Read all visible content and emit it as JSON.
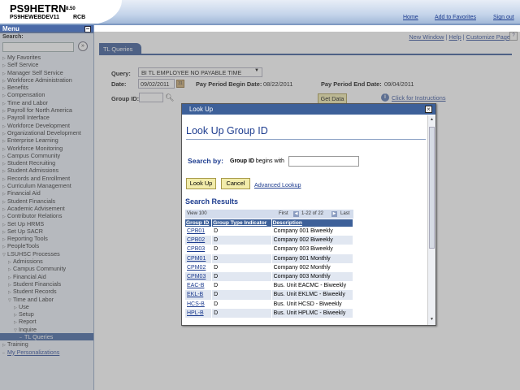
{
  "header": {
    "app_title": "PS9HETRN",
    "app_version": "8.50",
    "database": "PS9HEWEBDEV11",
    "user_id": "RCB",
    "links": {
      "home": "Home",
      "add_to_favorites": "Add to Favorites",
      "sign_out": "Sign out"
    }
  },
  "menu": {
    "title": "Menu",
    "collapse_glyph": "−",
    "search_label": "Search:",
    "search_go_glyph": "»",
    "items": [
      {
        "label": "My Favorites",
        "level": 0,
        "expanded": false
      },
      {
        "label": "Self Service",
        "level": 0,
        "expanded": false
      },
      {
        "label": "Manager Self Service",
        "level": 0,
        "expanded": false
      },
      {
        "label": "Workforce Administration",
        "level": 0,
        "expanded": false
      },
      {
        "label": "Benefits",
        "level": 0,
        "expanded": false
      },
      {
        "label": "Compensation",
        "level": 0,
        "expanded": false
      },
      {
        "label": "Time and Labor",
        "level": 0,
        "expanded": false
      },
      {
        "label": "Payroll for North America",
        "level": 0,
        "expanded": false
      },
      {
        "label": "Payroll Interface",
        "level": 0,
        "expanded": false
      },
      {
        "label": "Workforce Development",
        "level": 0,
        "expanded": false
      },
      {
        "label": "Organizational Development",
        "level": 0,
        "expanded": false
      },
      {
        "label": "Enterprise Learning",
        "level": 0,
        "expanded": false
      },
      {
        "label": "Workforce Monitoring",
        "level": 0,
        "expanded": false
      },
      {
        "label": "Campus Community",
        "level": 0,
        "expanded": false
      },
      {
        "label": "Student Recruiting",
        "level": 0,
        "expanded": false
      },
      {
        "label": "Student Admissions",
        "level": 0,
        "expanded": false
      },
      {
        "label": "Records and Enrollment",
        "level": 0,
        "expanded": false
      },
      {
        "label": "Curriculum Management",
        "level": 0,
        "expanded": false
      },
      {
        "label": "Financial Aid",
        "level": 0,
        "expanded": false
      },
      {
        "label": "Student Financials",
        "level": 0,
        "expanded": false
      },
      {
        "label": "Academic Advisement",
        "level": 0,
        "expanded": false
      },
      {
        "label": "Contributor Relations",
        "level": 0,
        "expanded": false
      },
      {
        "label": "Set Up HRMS",
        "level": 0,
        "expanded": false
      },
      {
        "label": "Set Up SACR",
        "level": 0,
        "expanded": false
      },
      {
        "label": "Reporting Tools",
        "level": 0,
        "expanded": false
      },
      {
        "label": "PeopleTools",
        "level": 0,
        "expanded": false
      },
      {
        "label": "LSUHSC Processes",
        "level": 0,
        "expanded": true
      },
      {
        "label": "Admissions",
        "level": 1,
        "expanded": false
      },
      {
        "label": "Campus Community",
        "level": 1,
        "expanded": false
      },
      {
        "label": "Financial Aid",
        "level": 1,
        "expanded": false
      },
      {
        "label": "Student Financials",
        "level": 1,
        "expanded": false
      },
      {
        "label": "Student Records",
        "level": 1,
        "expanded": false
      },
      {
        "label": "Time and Labor",
        "level": 1,
        "expanded": true
      },
      {
        "label": "Use",
        "level": 2,
        "expanded": false
      },
      {
        "label": "Setup",
        "level": 2,
        "expanded": false
      },
      {
        "label": "Report",
        "level": 2,
        "expanded": false
      },
      {
        "label": "Inquire",
        "level": 2,
        "expanded": true
      },
      {
        "label": "TL Queries",
        "level": 3,
        "selected": true
      },
      {
        "label": "Training",
        "level": 0,
        "expanded": false
      },
      {
        "label": "My Personalizations",
        "level": 0,
        "link": true
      }
    ]
  },
  "page": {
    "links": {
      "new_window": "New Window",
      "sep1": " | ",
      "help": "Help",
      "sep2": " | ",
      "customize_page": "Customize Page"
    },
    "tab_label": "TL Queries",
    "query_label": "Query:",
    "query_value": "BI TL EMPLOYEE NO PAYABLE TIME",
    "date_label": "Date:",
    "date_value": "09/02/2011",
    "pay_period_begin_label": "Pay Period Begin Date:",
    "pay_period_begin_value": "08/22/2011",
    "pay_period_end_label": "Pay Period End Date:",
    "pay_period_end_value": "09/04/2011",
    "group_id_label": "Group ID:",
    "get_data_label": "Get Data",
    "instructions_link": "Click for Instructions"
  },
  "lookup_modal": {
    "title": "Look Up",
    "close_glyph": "×",
    "heading": "Look Up Group ID",
    "search_by_label": "Search by:",
    "field_label": "Group ID",
    "operator": "begins with",
    "search_value": "",
    "lookup_button": "Look Up",
    "cancel_button": "Cancel",
    "advanced_lookup": "Advanced Lookup",
    "results_heading": "Search Results",
    "nav": {
      "view_all": "View 100",
      "first": "First",
      "range": "1-22 of 22",
      "last": "Last"
    },
    "columns": [
      "Group ID",
      "Group Type Indicator",
      "Description"
    ],
    "rows": [
      [
        "CPB01",
        "D",
        "Company 001 Biweekly"
      ],
      [
        "CPB02",
        "D",
        "Company 002 Biweekly"
      ],
      [
        "CPB03",
        "D",
        "Company 003 Biweekly"
      ],
      [
        "CPM01",
        "D",
        "Company 001 Monthly"
      ],
      [
        "CPM02",
        "D",
        "Company 002 Monthly"
      ],
      [
        "CPM03",
        "D",
        "Company 003 Monthly"
      ],
      [
        "EAC-B",
        "D",
        "Bus. Unit EACMC - Biweekly"
      ],
      [
        "EKL-B",
        "D",
        "Bus. Unit EKLMC - Biweekly"
      ],
      [
        "HCS-B",
        "D",
        "Bus. Unit HCSD - Biweekly"
      ],
      [
        "HPL-B",
        "D",
        "Bus. Unit HPLMC - Biweekly"
      ]
    ]
  }
}
